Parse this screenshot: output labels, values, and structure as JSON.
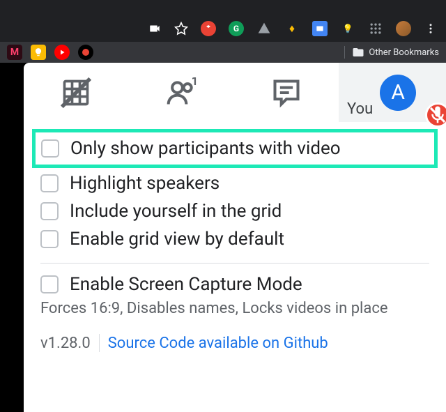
{
  "browser": {
    "other_bookmarks_label": "Other Bookmarks"
  },
  "tabs": {
    "you_label": "You",
    "avatar_initial": "A"
  },
  "options": {
    "only_video": "Only show participants with video",
    "highlight_speakers": "Highlight speakers",
    "include_self": "Include yourself in the grid",
    "enable_default": "Enable grid view by default",
    "screen_capture": "Enable Screen Capture Mode",
    "screen_capture_desc": "Forces 16:9, Disables names, Locks videos in place"
  },
  "footer": {
    "version": "v1.28.0",
    "github_label": "Source Code available on Github"
  }
}
